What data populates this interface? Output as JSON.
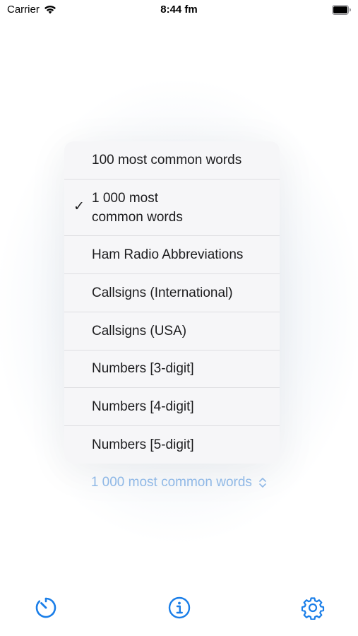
{
  "status_bar": {
    "carrier": "Carrier",
    "time": "8:44 fm"
  },
  "menu": {
    "items": [
      {
        "label": "100 most common words",
        "selected": false
      },
      {
        "label": "1 000 most\ncommon words",
        "selected": true
      },
      {
        "label": "Ham Radio Abbreviations",
        "selected": false
      },
      {
        "label": "Callsigns (International)",
        "selected": false
      },
      {
        "label": "Callsigns (USA)",
        "selected": false
      },
      {
        "label": "Numbers [3-digit]",
        "selected": false
      },
      {
        "label": "Numbers [4-digit]",
        "selected": false
      },
      {
        "label": "Numbers [5-digit]",
        "selected": false
      }
    ],
    "checkmark": "✓"
  },
  "selector": {
    "label": "1 000 most common words",
    "icon": "chevron-up-down-icon"
  },
  "toolbar": {
    "items": [
      {
        "icon": "timer-icon"
      },
      {
        "icon": "info-icon"
      },
      {
        "icon": "gear-icon"
      }
    ]
  },
  "colors": {
    "accent": "#1a7ee8",
    "selector_text": "#8fb8e6"
  }
}
